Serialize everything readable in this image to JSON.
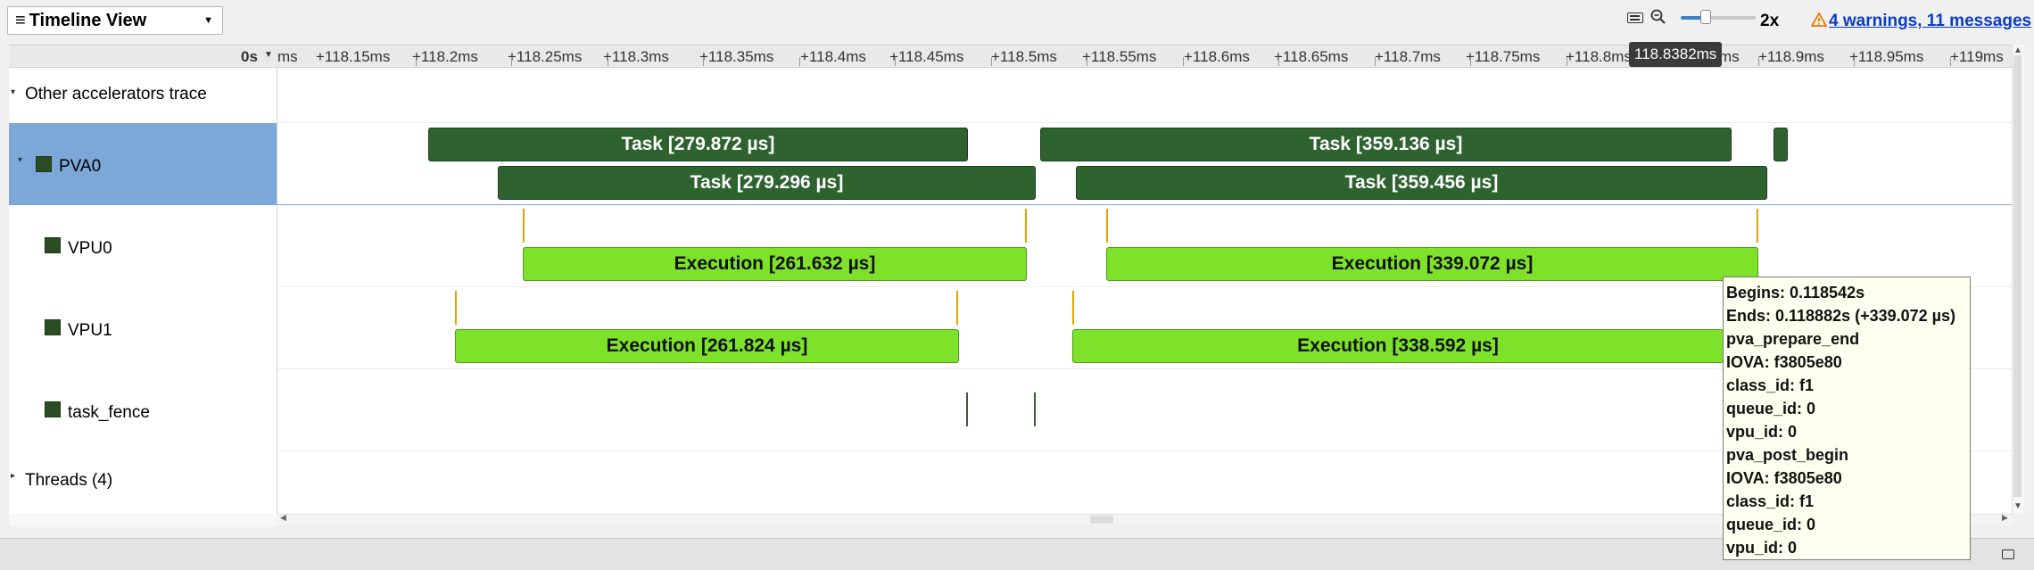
{
  "toolbar": {
    "view_label": "Timeline View",
    "zoom_level": "2x",
    "warnings_link": "4 warnings, 11 messages"
  },
  "ruler": {
    "origin": "0s",
    "cursor_time": "118.8382ms",
    "ticks": [
      "ms",
      "+118.15ms",
      "+118.2ms",
      "+118.25ms",
      "+118.3ms",
      "+118.35ms",
      "+118.4ms",
      "+118.45ms",
      "+118.5ms",
      "+118.55ms",
      "+118.6ms",
      "+118.65ms",
      "+118.7ms",
      "+118.75ms",
      "+118.8ms",
      "ms",
      "+118.9ms",
      "+118.95ms",
      "+119ms"
    ]
  },
  "tree": {
    "other_accelerators": "Other accelerators trace",
    "pva0": "PVA0",
    "vpu0": "VPU0",
    "vpu1": "VPU1",
    "task_fence": "task_fence",
    "threads": "Threads (4)"
  },
  "bars": {
    "pva0_task_1": "Task [279.872 µs]",
    "pva0_task_2": "Task [359.136 µs]",
    "pva0_task_3": "Task [279.296 µs]",
    "pva0_task_4": "Task [359.456 µs]",
    "vpu0_exec_1": "Execution [261.632 µs]",
    "vpu0_exec_2": "Execution [339.072 µs]",
    "vpu1_exec_1": "Execution [261.824 µs]",
    "vpu1_exec_2": "Execution [338.592 µs]"
  },
  "tooltip": {
    "lines": [
      "Begins: 0.118542s",
      "Ends: 0.118882s (+339.072 µs)",
      "pva_prepare_end",
      "IOVA: f3805e80",
      "class_id: f1",
      "queue_id: 0",
      "vpu_id: 0",
      "pva_post_begin",
      "IOVA: f3805e80",
      "class_id: f1",
      "queue_id: 0",
      "vpu_id: 0"
    ]
  },
  "colors": {
    "task_bar": "#2e6330",
    "exec_bar": "#7ee22a",
    "selected_row": "#7ba8d8",
    "link": "#0a3cc8",
    "marker": "#e8a200"
  }
}
